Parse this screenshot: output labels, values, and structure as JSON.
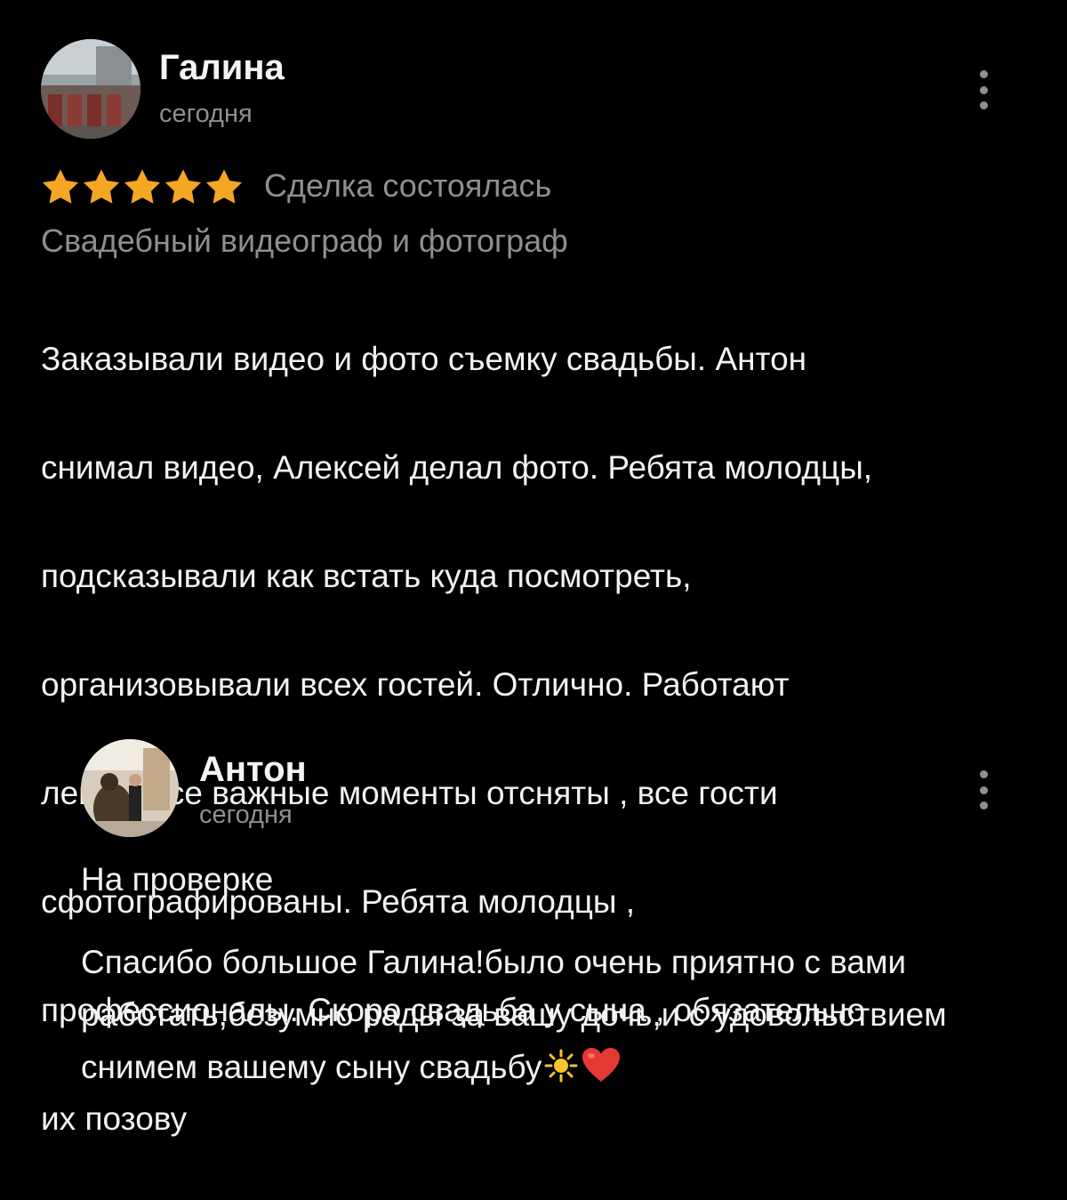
{
  "review": {
    "author": "Галина",
    "date": "сегодня",
    "rating": 5,
    "rating_max": 5,
    "deal_status": "Сделка состоялась",
    "category": "Свадебный видеограф и фотограф",
    "text_lines": [
      "Заказывали видео  и фото съемку свадьбы. Антон",
      "снимал видео, Алексей делал фото. Ребята молодцы,",
      "подсказывали как встать куда посмотреть,",
      "организовывали всех гостей. Отлично. Работают",
      "легко , все важные моменты отсняты , все гости",
      "сфотографированы. Ребята молодцы ,",
      "профессионалы. Скоро свадьба у сына , обязательно",
      "их позову"
    ],
    "menu_icon": "more-vertical-icon"
  },
  "reply": {
    "author": "Антон",
    "date": "сегодня",
    "status": "На проверке",
    "text": "Спасибо большое Галина!было очень приятно с вами работать,безумно рады за вашу дочь,и с удовольствием снимем вашему сыну свадьбу",
    "emojis": [
      "sun-emoji",
      "heart-emoji"
    ],
    "menu_icon": "more-vertical-icon"
  },
  "colors": {
    "background": "#000000",
    "text": "#f2f2f2",
    "secondary_text": "#8e8e93",
    "star": "#f5a623",
    "heart": "#e53935",
    "sun": "#f7c52b"
  }
}
